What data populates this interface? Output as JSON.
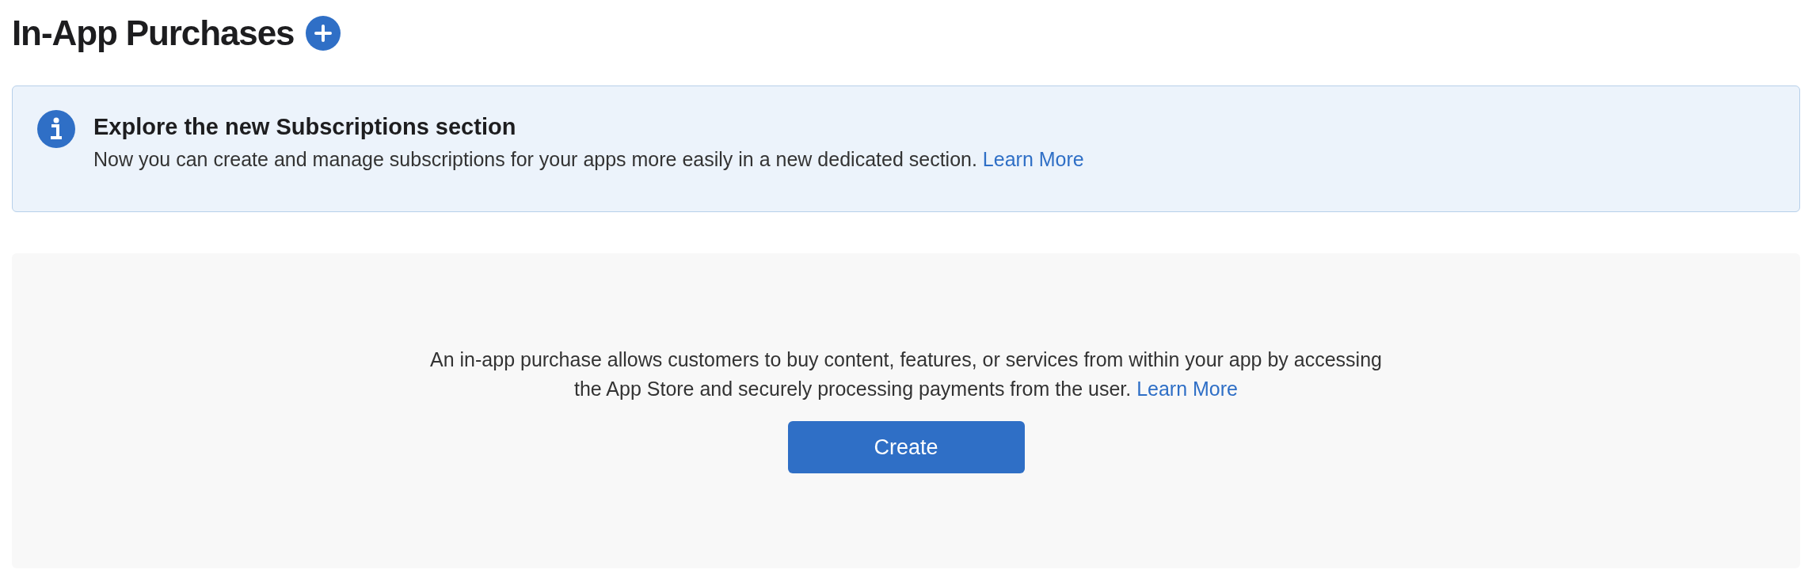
{
  "page": {
    "title": "In-App Purchases"
  },
  "notice": {
    "heading": "Explore the new Subscriptions section",
    "body": "Now you can create and manage subscriptions for your apps more easily in a new dedicated section.",
    "link": "Learn More"
  },
  "empty_state": {
    "description": "An in-app purchase allows customers to buy content, features, or services from within your app by accessing the App Store and securely processing payments from the user.",
    "link": "Learn More",
    "button": "Create"
  }
}
